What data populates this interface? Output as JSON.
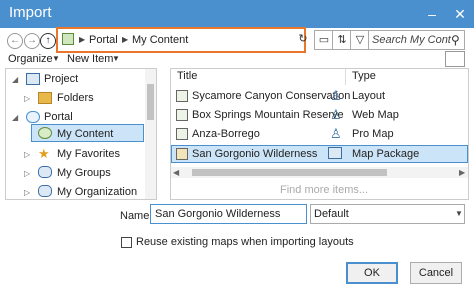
{
  "window": {
    "title": "Import",
    "minimize_glyph": "–",
    "close_glyph": "✕"
  },
  "nav": {
    "back_icon": "back-arrow-icon",
    "forward_icon": "forward-arrow-icon",
    "up_icon": "up-arrow-icon",
    "breadcrumb": [
      "Portal",
      "My Content"
    ],
    "search_placeholder": "Search My Cont"
  },
  "toolbar": {
    "organize_label": "Organize",
    "new_item_label": "New Item"
  },
  "tree": {
    "items": [
      {
        "label": "Project",
        "icon": "project-icon"
      },
      {
        "label": "Folders",
        "icon": "folder-icon"
      },
      {
        "label": "Portal",
        "icon": "cloud-icon"
      },
      {
        "label": "My Content",
        "icon": "user-icon"
      },
      {
        "label": "My Favorites",
        "icon": "star-icon"
      },
      {
        "label": "My Groups",
        "icon": "group-icon"
      },
      {
        "label": "My Organization",
        "icon": "organization-icon"
      }
    ]
  },
  "table": {
    "columns": [
      "Title",
      "Type"
    ],
    "rows": [
      {
        "title": "Sycamore Canyon Conservation",
        "type": "Layout"
      },
      {
        "title": "Box Springs Mountain Reserve",
        "type": "Web Map"
      },
      {
        "title": "Anza-Borrego",
        "type": "Pro Map"
      },
      {
        "title": "San Gorgonio Wilderness",
        "type": "Map Package"
      }
    ],
    "find_more": "Find more items..."
  },
  "form": {
    "name_label": "Name",
    "name_value": "San Gorgonio Wilderness",
    "type_value": "Default",
    "checkbox_label": "Reuse existing maps when importing layouts"
  },
  "buttons": {
    "ok": "OK",
    "cancel": "Cancel"
  },
  "colors": {
    "titlebar": "#4a90cf",
    "address_highlight": "#e8762b",
    "selection": "#cce4f7"
  }
}
